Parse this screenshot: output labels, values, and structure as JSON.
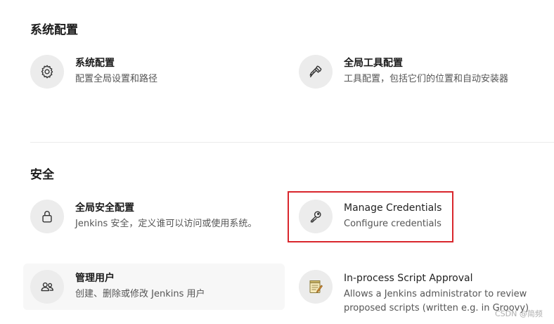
{
  "sections": {
    "system": {
      "title": "系统配置",
      "items": [
        {
          "title": "系统配置",
          "desc": "配置全局设置和路径",
          "icon": "gear-icon"
        },
        {
          "title": "全局工具配置",
          "desc": "工具配置，包括它们的位置和自动安装器",
          "icon": "hammer-icon"
        }
      ]
    },
    "security": {
      "title": "安全",
      "items": [
        {
          "title": "全局安全配置",
          "desc": "Jenkins 安全，定义谁可以访问或使用系统。",
          "icon": "lock-icon"
        },
        {
          "title": "Manage Credentials",
          "desc": "Configure credentials",
          "icon": "key-icon"
        },
        {
          "title": "管理用户",
          "desc": "创建、删除或修改 Jenkins 用户",
          "icon": "users-icon"
        },
        {
          "title": "In-process Script Approval",
          "desc": "Allows a Jenkins administrator to review proposed scripts (written e.g. in Groovy)",
          "icon": "notepad-icon"
        }
      ]
    }
  },
  "watermark": "CSDN @简频",
  "colors": {
    "highlight": "#d9262c",
    "icon_bg": "#ececec"
  }
}
